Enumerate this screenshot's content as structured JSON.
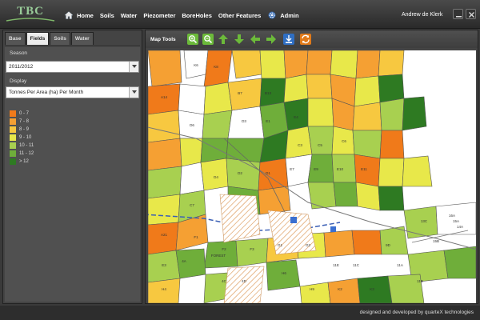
{
  "app": {
    "logo_text": "TBC",
    "user_name": "Andrew de Klerk"
  },
  "nav": {
    "items": [
      {
        "label": "Home",
        "icon": "home-icon"
      },
      {
        "label": "Soils"
      },
      {
        "label": "Water"
      },
      {
        "label": "Piezometer"
      },
      {
        "label": "BoreHoles"
      },
      {
        "label": "Other Features"
      },
      {
        "label": "Admin",
        "icon": "gear-icon"
      }
    ]
  },
  "left_panel": {
    "tabs": [
      "Base",
      "Fields",
      "Soils",
      "Water"
    ],
    "active_tab": "Fields",
    "season_label": "Season",
    "season_value": "2011/2012",
    "display_label": "Display",
    "display_value": "Tonnes Per Area (ha) Per Month",
    "legend": [
      {
        "label": "0 - 7",
        "color": "#f07a1a"
      },
      {
        "label": "7 - 8",
        "color": "#f5a033"
      },
      {
        "label": "8 - 9",
        "color": "#f7c840"
      },
      {
        "label": "9 - 10",
        "color": "#e8e84a"
      },
      {
        "label": "10 - 11",
        "color": "#a8d050"
      },
      {
        "label": "11 - 12",
        "color": "#6fae3a"
      },
      {
        "label": "> 12",
        "color": "#2e7a22"
      }
    ]
  },
  "map": {
    "toolbar_label": "Map Tools",
    "tools": [
      "zoom-in-icon",
      "zoom-out-icon",
      "pan-up-icon",
      "pan-down-icon",
      "pan-left-icon",
      "pan-right-icon",
      "download-icon",
      "refresh-icon"
    ],
    "field_labels": [
      "K6",
      "K8",
      "A14",
      "B7",
      "B13",
      "E1",
      "E4",
      "D6",
      "D3",
      "C3",
      "C5",
      "C6",
      "E11",
      "E10",
      "E9",
      "E7",
      "D2",
      "D1",
      "D4",
      "C7",
      "A21",
      "FOREST",
      "16A",
      "15A",
      "14A",
      "15B",
      "13C",
      "9D",
      "4A",
      "4C",
      "4D",
      "11A",
      "11B",
      "11C",
      "11E",
      "E3",
      "F1",
      "F2",
      "F3",
      "G1",
      "G2",
      "H4",
      "H6",
      "H9",
      "K2",
      "K3"
    ]
  },
  "footer": {
    "text": "designed and developed by quarteX technologies"
  }
}
